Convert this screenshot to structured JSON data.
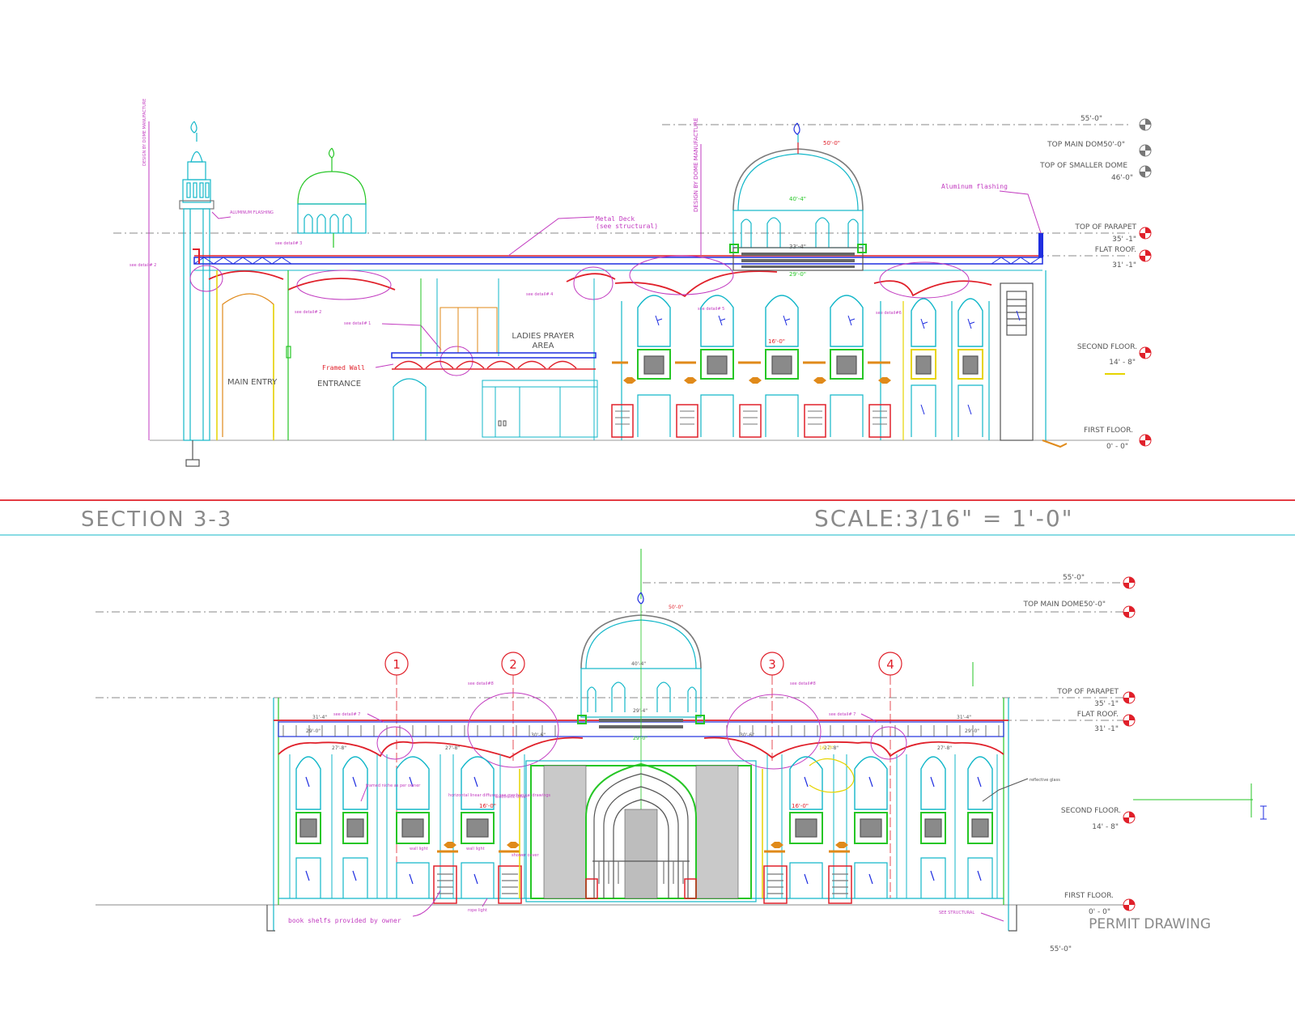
{
  "colors": {
    "cyan": "#13b7c9",
    "blue": "#1f2ee0",
    "red": "#e0202a",
    "magenta": "#c23bc0",
    "green": "#26c626",
    "orange": "#e08a1a",
    "gray": "#7a7a7a",
    "dark": "#444444",
    "yellow": "#e6d400"
  },
  "section1": {
    "levels": {
      "top": "55'-0\"",
      "top_main_dome": "TOP MAIN DOM50'-0\"",
      "top_smaller_dome": "TOP OF SMALLER DOME",
      "smaller_dome_value": "46'-0\"",
      "top_parapet": "TOP OF PARAPET",
      "parapet_value": "35' -1\"",
      "flat_roof": "FLAT ROOF.",
      "flat_roof_value": "31' -1\"",
      "second_floor": "SECOND FLOOR.",
      "second_floor_value": "14' - 8\"",
      "first_floor": "FIRST FLOOR.",
      "first_floor_value": "0' - 0\""
    },
    "notes": {
      "minaret_vertical": "DESIGN BY DOME MANUFACTURE",
      "dome_vertical": "DESIGN BY DOME MANUFACTURE",
      "aluminum_small": "ALUMINUM FLASHING",
      "metal_deck": "Metal Deck",
      "see_structural": "(see structural)",
      "aluminum_flashing": "Aluminum flashing",
      "see_detail_a": "see detail# 3",
      "see_detail_b": "see detail# 2",
      "see_detail_c": "see detail# 2",
      "see_detail_d": "see detail# 1",
      "see_detail_e": "see detail# 4",
      "see_detail_f": "see detail# 5",
      "see_detail_g": "see detail#6",
      "framed_wall": "Framed Wall",
      "dim_dome_top": "50'-0\"",
      "dim_dome_mid": "40'-4\"",
      "dim_dome_base": "33'-4\"",
      "dim_dome_low": "29'-0\"",
      "dim_window": "16'-0\""
    },
    "rooms": {
      "main_entry": "MAIN ENTRY",
      "entrance": "ENTRANCE",
      "ladies_line1": "LADIES PRAYER",
      "ladies_line2": "AREA"
    }
  },
  "title_bar": {
    "section": "SECTION 3-3",
    "scale": "SCALE:3/16\" = 1'-0\""
  },
  "section2": {
    "levels": {
      "top": "55'-0\"",
      "top_main_dome": "TOP MAIN DOME50'-0\"",
      "top_parapet": "TOP OF PARAPET",
      "parapet_value": "35' -1\"",
      "flat_roof": "FLAT ROOF.",
      "flat_roof_value": "31' -1\"",
      "second_floor": "SECOND FLOOR.",
      "second_floor_value": "14' - 8\"",
      "first_floor": "FIRST FLOOR.",
      "first_floor_value": "0' - 0\""
    },
    "grid": [
      "1",
      "2",
      "3",
      "4"
    ],
    "notes": {
      "see_detail_left": "see detail#8",
      "see_detail_right": "see detail#8",
      "see_detail_7a": "see detail# 7",
      "see_detail_7b": "see detail# 7",
      "framed_niche": "framed niche as per owner",
      "diffuser": "horizontal linear diffuser see mechanical drawings",
      "electronic_timer": "electronic timer",
      "wall_light": "wall light",
      "wall_light_b": "wall light",
      "shower_cover": "shower cover",
      "rope_light": "rope light",
      "book_shelfs": "book shelfs provided by owner",
      "see_structural": "SEE STRUCTURAL",
      "reflective_glass": "reflective glass",
      "dim_top": "50'-0\"",
      "dim_dome": "40'-4\"",
      "dim_base": "29'-4\"",
      "dim_low": "29'-0\"",
      "dim_31_left": "31'-4\"",
      "dim_31_right": "31'-4\"",
      "dim_27_a": "27'-8\"",
      "dim_27_b": "27'-8\"",
      "dim_27_c": "27'-8\"",
      "dim_27_d": "27'-8\"",
      "dim_30_a": "30'-6\"",
      "dim_30_b": "30'-6\"",
      "dim_16_a": "16'-0\"",
      "dim_16_b": "16'-0\"",
      "dim_16_c": "16'-0\"",
      "dim_29_a": "29'-0\"",
      "dim_29_b": "29'-0\"",
      "permit": "PERMIT DRAWING",
      "bottom_level": "55'-0\""
    }
  }
}
